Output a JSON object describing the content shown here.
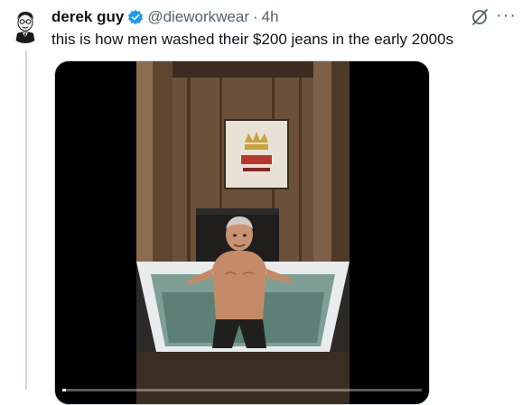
{
  "tweet": {
    "author_name": "derek guy",
    "handle": "@dieworkwear",
    "separator": "·",
    "time": "4h",
    "text": "this is how men washed their $200 jeans in the early 2000s",
    "more_label": "···"
  },
  "icons": {
    "verified": "verified-badge-icon",
    "grok": "grok-icon",
    "more": "more-icon"
  },
  "media": {
    "type": "video",
    "progress": 0.01
  },
  "colors": {
    "verified": "#1d9bf0",
    "secondary_text": "#536471",
    "border": "#cfd9de"
  }
}
